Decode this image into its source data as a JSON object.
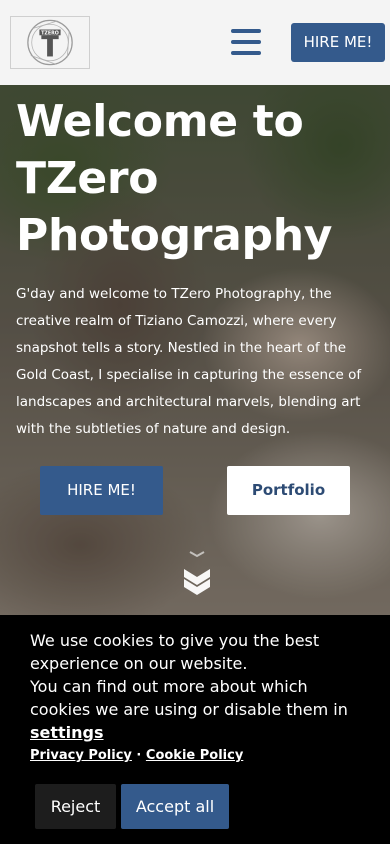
{
  "header": {
    "logo_text": "TZERO",
    "hire_label": "HIRE ME!"
  },
  "hero": {
    "title": "Welcome to TZero Photography",
    "intro": "G'day and welcome to TZero Photography, the creative realm of Tiziano Camozzi, where every snapshot tells a story. Nestled in the heart of the Gold Coast, I specialise in capturing the essence of landscapes and architectural marvels, blending art with the subtleties of nature and design.",
    "hire_label": "HIRE ME!",
    "portfolio_label": "Portfolio"
  },
  "cookie": {
    "message": "We use cookies to give you the best experience on our website.\nYou can find out more about which cookies we are using or disable them in",
    "settings_label": "settings",
    "privacy_label": "Privacy Policy",
    "separator": " · ",
    "cookie_policy_label": "Cookie Policy",
    "reject_label": "Reject",
    "accept_label": "Accept all"
  },
  "colors": {
    "accent": "#345a8c",
    "header_bg": "#f4f4f4",
    "cookie_bg": "#000000"
  },
  "icons": {
    "menu": "hamburger-menu-icon",
    "scroll": "chevron-double-down-icon"
  }
}
